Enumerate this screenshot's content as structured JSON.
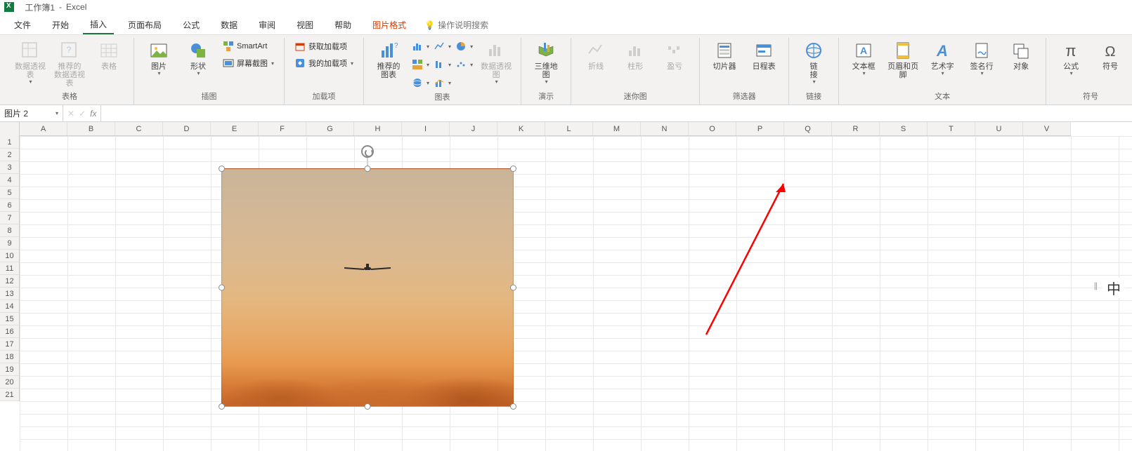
{
  "titlebar": {
    "workbook_name": "工作簿1",
    "app_name": "Excel"
  },
  "tabs": {
    "file": "文件",
    "home": "开始",
    "insert": "插入",
    "page_layout": "页面布局",
    "formulas": "公式",
    "data": "数据",
    "review": "审阅",
    "view": "视图",
    "help": "帮助",
    "picture_format": "图片格式",
    "tell_me": "操作说明搜索"
  },
  "ribbon": {
    "tables": {
      "pivot_table": "数据透视表",
      "rec_pivot": "推荐的\n数据透视表",
      "table": "表格",
      "group": "表格"
    },
    "illus": {
      "pictures": "图片",
      "shapes": "形状",
      "smartart": "SmartArt",
      "screenshot": "屏幕截图",
      "group": "插图"
    },
    "addins": {
      "get": "获取加载项",
      "my": "我的加载项",
      "group": "加载项"
    },
    "charts": {
      "rec": "推荐的\n图表",
      "pivotchart": "数据透视图",
      "group": "图表"
    },
    "tours": {
      "map3d": "三维地\n图",
      "group": "演示"
    },
    "sparklines": {
      "line": "折线",
      "column": "柱形",
      "winloss": "盈亏",
      "group": "迷你图"
    },
    "filters": {
      "slicer": "切片器",
      "timeline": "日程表",
      "group": "筛选器"
    },
    "links": {
      "link": "链\n接",
      "group": "链接"
    },
    "text": {
      "textbox": "文本框",
      "hf": "页眉和页脚",
      "wordart": "艺术字",
      "sig": "签名行",
      "object": "对象",
      "group": "文本"
    },
    "symbols": {
      "equation": "公式",
      "symbol": "符号",
      "group": "符号"
    }
  },
  "name_box": "图片 2",
  "formula": "",
  "columns": [
    "A",
    "B",
    "C",
    "D",
    "E",
    "F",
    "G",
    "H",
    "I",
    "J",
    "K",
    "L",
    "M",
    "N",
    "O",
    "P",
    "Q",
    "R",
    "S",
    "T",
    "U",
    "V"
  ],
  "rows": [
    "1",
    "2",
    "3",
    "4",
    "5",
    "6",
    "7",
    "8",
    "9",
    "10",
    "11",
    "12",
    "13",
    "14",
    "15",
    "16",
    "17",
    "18",
    "19",
    "20",
    "21"
  ],
  "ime": "中"
}
